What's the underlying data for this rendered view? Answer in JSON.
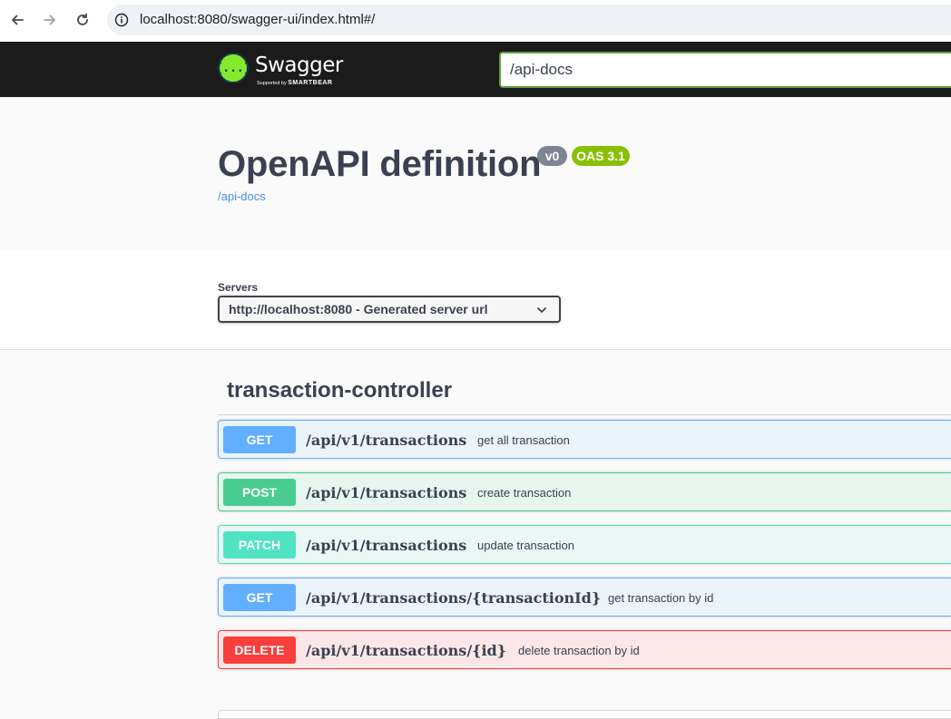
{
  "browser": {
    "url": "localhost:8080/swagger-ui/index.html#/"
  },
  "topbar": {
    "logo_word": "Swagger",
    "logo_glyph": "{...}",
    "logo_sub_prefix": "Supported by",
    "logo_sub_brand": "SMARTBEAR",
    "definition_url": "/api-docs"
  },
  "info": {
    "title": "OpenAPI definition",
    "version": "v0",
    "oas": "OAS 3.1",
    "link": "/api-docs"
  },
  "servers": {
    "label": "Servers",
    "selected": "http://localhost:8080 - Generated server url"
  },
  "tag": {
    "name": "transaction-controller"
  },
  "operations": [
    {
      "method": "GET",
      "path": "/api/v1/transactions",
      "summary": "get all transaction"
    },
    {
      "method": "POST",
      "path": "/api/v1/transactions",
      "summary": "create transaction"
    },
    {
      "method": "PATCH",
      "path": "/api/v1/transactions",
      "summary": "update transaction"
    },
    {
      "method": "GET",
      "path": "/api/v1/transactions/{transactionId}",
      "summary": "get transaction by id"
    },
    {
      "method": "DELETE",
      "path": "/api/v1/transactions/{id}",
      "summary": "delete transaction by id"
    }
  ],
  "colors": {
    "get": "#61affe",
    "post": "#49cc90",
    "patch": "#50e3c2",
    "delete": "#f93e3e",
    "topbar": "#1b1b1b",
    "logo_green": "#85ea2d"
  },
  "icons": [
    "back-arrow-icon",
    "forward-arrow-icon",
    "reload-icon",
    "info-icon",
    "swagger-logo-icon",
    "chevron-down-icon"
  ]
}
